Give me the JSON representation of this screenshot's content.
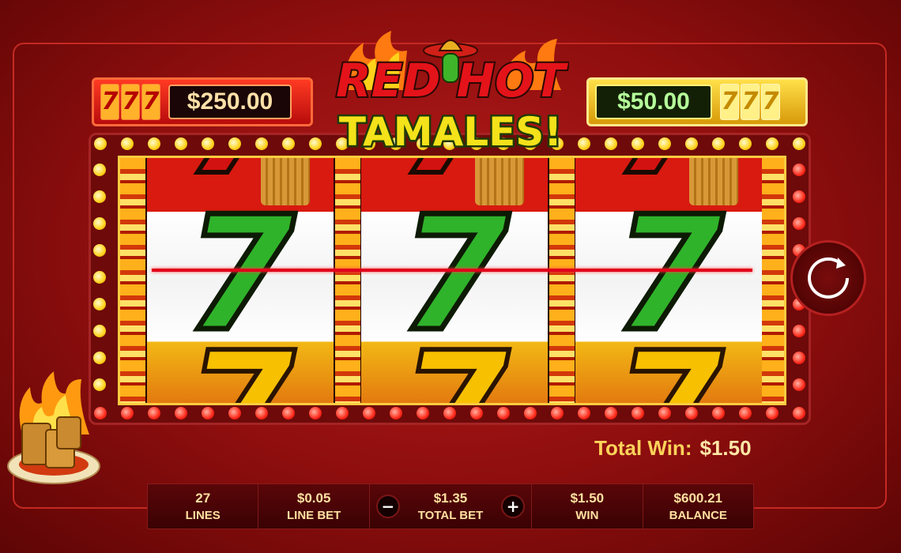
{
  "game": {
    "logo_line1": "RED HOT",
    "logo_line2": "TAMALES!"
  },
  "jackpots": {
    "left": {
      "symbols": [
        "7",
        "7",
        "7"
      ],
      "value": "$250.00",
      "color": "#d81a10"
    },
    "right": {
      "symbols": [
        "7",
        "7",
        "7"
      ],
      "value": "$50.00",
      "color": "#f2c012"
    }
  },
  "reels": [
    {
      "top": "7",
      "middle": "7",
      "bottom": "7"
    },
    {
      "top": "7",
      "middle": "7",
      "bottom": "7"
    },
    {
      "top": "7",
      "middle": "7",
      "bottom": "7"
    }
  ],
  "total_win": {
    "label": "Total Win:",
    "value": "$1.50"
  },
  "bottom_bar": {
    "lines": {
      "value": "27",
      "label": "LINES"
    },
    "line_bet": {
      "value": "$0.05",
      "label": "LINE BET"
    },
    "total_bet": {
      "value": "$1.35",
      "label": "TOTAL BET",
      "minus": "−",
      "plus": "+"
    },
    "win": {
      "value": "$1.50",
      "label": "WIN"
    },
    "balance": {
      "value": "$600.21",
      "label": "BALANCE"
    }
  },
  "icons": {
    "spin": "spin-refresh-icon",
    "plate": "tamale-plate-icon"
  },
  "colors": {
    "background": "#9e1212",
    "accent_gold": "#ffd35a",
    "seven_green": "#2fb32a",
    "seven_red": "#d21210",
    "seven_gold": "#f7c000"
  }
}
